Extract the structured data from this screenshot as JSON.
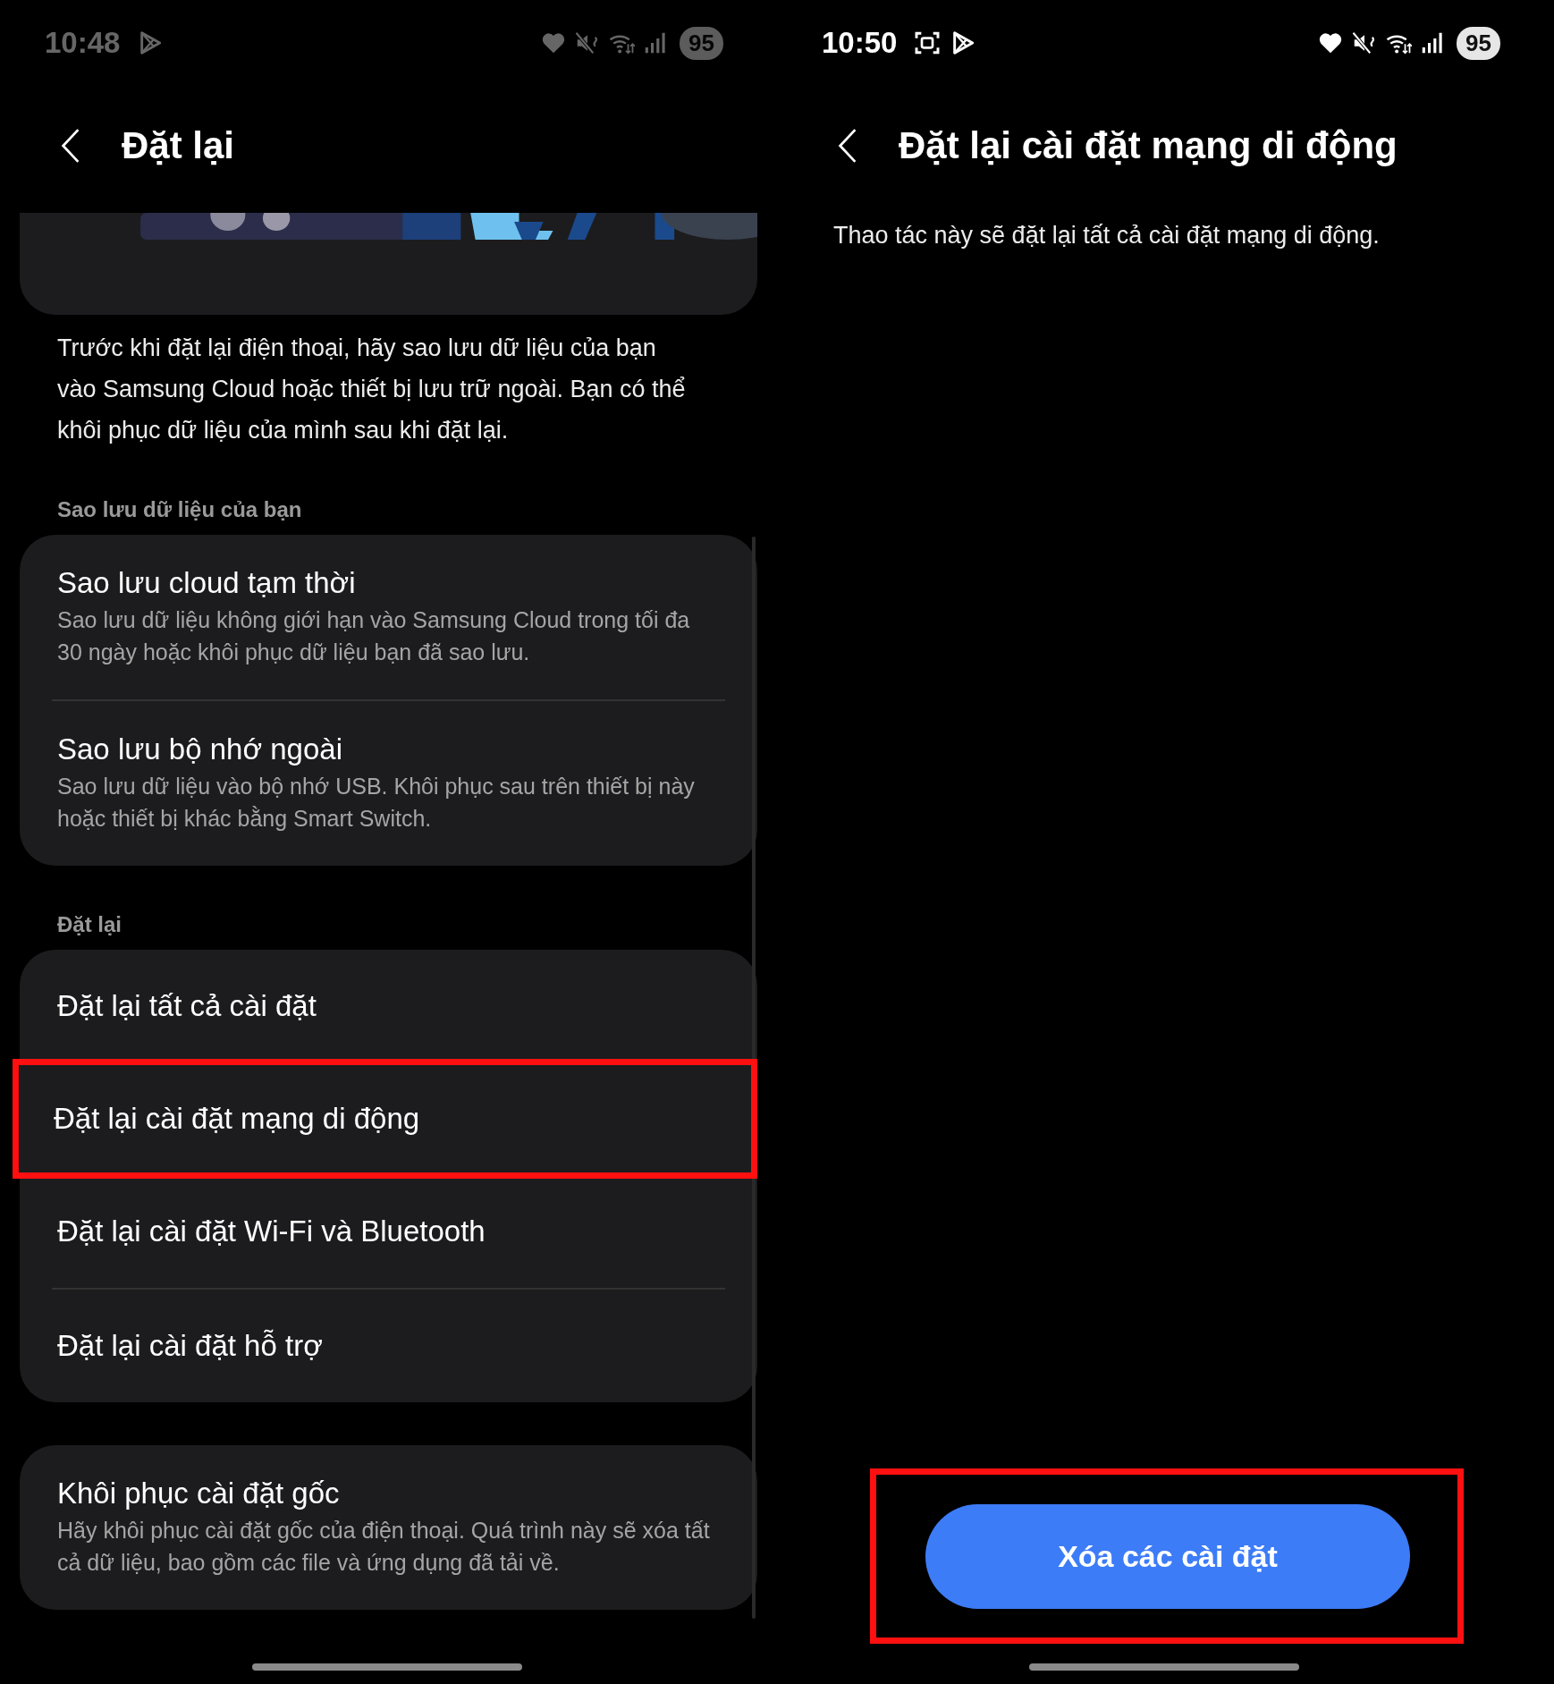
{
  "screens": [
    {
      "status_bar": {
        "time": "10:48",
        "notification_icons": [
          {
            "kind": "play"
          }
        ],
        "battery": "95",
        "dimmed": true
      },
      "header": {
        "title": "Đặt lại"
      },
      "banner": {
        "kind": "picture"
      },
      "intro": "Trước khi đặt lại điện thoại, hãy sao lưu dữ liệu của bạn vào Samsung Cloud hoặc thiết bị lưu trữ ngoài. Bạn có thể khôi phục dữ liệu của mình sau khi đặt lại.",
      "sections": [
        {
          "title": "Sao lưu dữ liệu của bạn",
          "items": [
            {
              "title": "Sao lưu cloud tạm thời",
              "subtitle": "Sao lưu dữ liệu không giới hạn vào Samsung Cloud trong tối đa 30 ngày hoặc khôi phục dữ liệu bạn đã sao lưu.",
              "highlighted": false
            },
            {
              "title": "Sao lưu bộ nhớ ngoài",
              "subtitle": "Sao lưu dữ liệu vào bộ nhớ USB. Khôi phục sau trên thiết bị này hoặc thiết bị khác bằng Smart Switch.",
              "highlighted": false
            }
          ]
        },
        {
          "title": "Đặt lại",
          "items": [
            {
              "title": "Đặt lại tất cả cài đặt",
              "highlighted": false
            },
            {
              "title": "Đặt lại cài đặt mạng di động",
              "highlighted": true
            },
            {
              "title": "Đặt lại cài đặt Wi-Fi và Bluetooth",
              "highlighted": false
            },
            {
              "title": "Đặt lại cài đặt hỗ trợ",
              "highlighted": false
            }
          ]
        },
        {
          "items": [
            {
              "title": "Khôi phục cài đặt gốc",
              "subtitle": "Hãy khôi phục cài đặt gốc của điện thoại. Quá trình này sẽ xóa tất cả dữ liệu, bao gồm các file và ứng dụng đã tải về.",
              "highlighted": false
            }
          ]
        }
      ]
    },
    {
      "status_bar": {
        "time": "10:50",
        "notification_icons": [
          {
            "kind": "screenshot"
          },
          {
            "kind": "play"
          }
        ],
        "battery": "95",
        "dimmed": false
      },
      "header": {
        "title": "Đặt lại cài đặt mạng di động"
      },
      "description": "Thao tác này sẽ đặt lại tất cả cài đặt mạng di động.",
      "button": {
        "label": "Xóa các cài đặt",
        "highlighted": true
      }
    }
  ]
}
